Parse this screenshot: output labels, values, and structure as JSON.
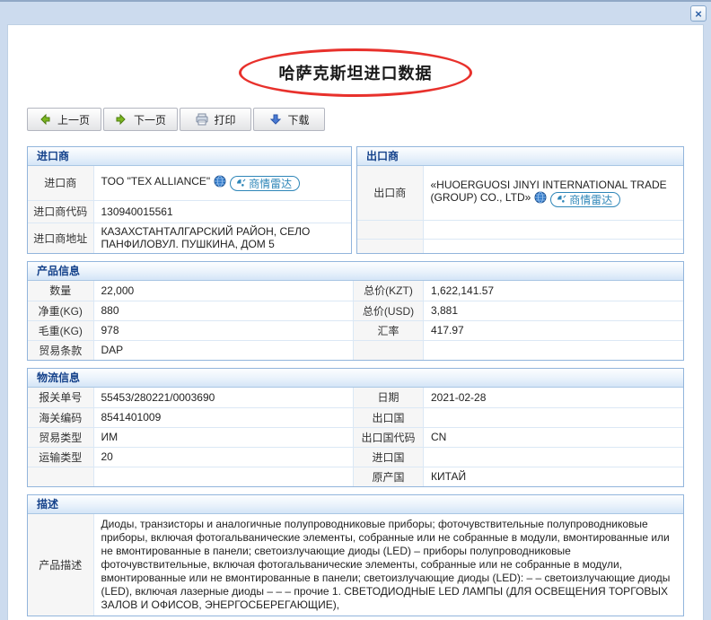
{
  "window": {
    "close_glyph": "×"
  },
  "title": "哈萨克斯坦进口数据",
  "toolbar": {
    "prev": "上一页",
    "next": "下一页",
    "print": "打印",
    "download": "下载"
  },
  "sections": {
    "importer": {
      "header": "进口商",
      "rows": [
        {
          "label": "进口商",
          "value": "TOO \"TEX ALLIANCE\"",
          "badge": "商情雷达"
        },
        {
          "label": "进口商代码",
          "value": "130940015561"
        },
        {
          "label": "进口商地址",
          "value": "КАЗАХСТАНТАЛГАРСКИЙ РАЙОН, СЕЛО ПАНФИЛОВУЛ. ПУШКИНА, ДОМ 5"
        }
      ]
    },
    "exporter": {
      "header": "出口商",
      "rows": [
        {
          "label": "出口商",
          "value": "«HUOERGUOSI JINYI INTERNATIONAL TRADE (GROUP) CO., LTD»",
          "badge": "商情雷达"
        },
        {
          "label": "",
          "value": ""
        },
        {
          "label": "",
          "value": ""
        }
      ]
    },
    "product": {
      "header": "产品信息",
      "rows": [
        {
          "l1": "数量",
          "v1": "22,000",
          "l2": "总价(KZT)",
          "v2": "1,622,141.57"
        },
        {
          "l1": "净重(KG)",
          "v1": "880",
          "l2": "总价(USD)",
          "v2": "3,881"
        },
        {
          "l1": "毛重(KG)",
          "v1": "978",
          "l2": "汇率",
          "v2": "417.97"
        },
        {
          "l1": "贸易条款",
          "v1": "DAP",
          "l2": "",
          "v2": ""
        }
      ]
    },
    "logistics": {
      "header": "物流信息",
      "rows": [
        {
          "l1": "报关单号",
          "v1": "55453/280221/0003690",
          "l2": "日期",
          "v2": "2021-02-28"
        },
        {
          "l1": "海关编码",
          "v1": "8541401009",
          "l2": "出口国",
          "v2": ""
        },
        {
          "l1": "贸易类型",
          "v1": "ИМ",
          "l2": "出口国代码",
          "v2": "CN"
        },
        {
          "l1": "运输类型",
          "v1": "20",
          "l2": "进口国",
          "v2": ""
        },
        {
          "l1": "",
          "v1": "",
          "l2": "原产国",
          "v2": "КИТАЙ"
        }
      ]
    },
    "description": {
      "header": "描述",
      "label": "产品描述",
      "value": "Диоды, транзисторы и аналогичные полупроводниковые приборы; фоточувствительные полупроводниковые приборы, включая фотогальванические элементы, собранные или не собранные в модули, вмонтированные или не вмонтированные в панели; светоизлучающие диоды (LED) – приборы полупроводниковые фоточувствительные, включая фотогальванические элементы, собранные или не собранные в модули, вмонтированные или не вмонтированные в панели; светоизлучающие диоды (LED): – – светоизлучающие диоды (LED), включая лазерные диоды – – – прочие 1. СВЕТОДИОДНЫЕ LED ЛАМПЫ (ДЛЯ ОСВЕЩЕНИЯ ТОРГОВЫХ ЗАЛОВ И ОФИСОВ, ЭНЕРГОСБЕРЕГАЮЩИЕ),"
    }
  },
  "colors": {
    "accent_blue": "#15428b",
    "link_blue": "#2e86b8",
    "ellipse_red": "#e8312c",
    "chrome_blue": "#ccdbee"
  }
}
